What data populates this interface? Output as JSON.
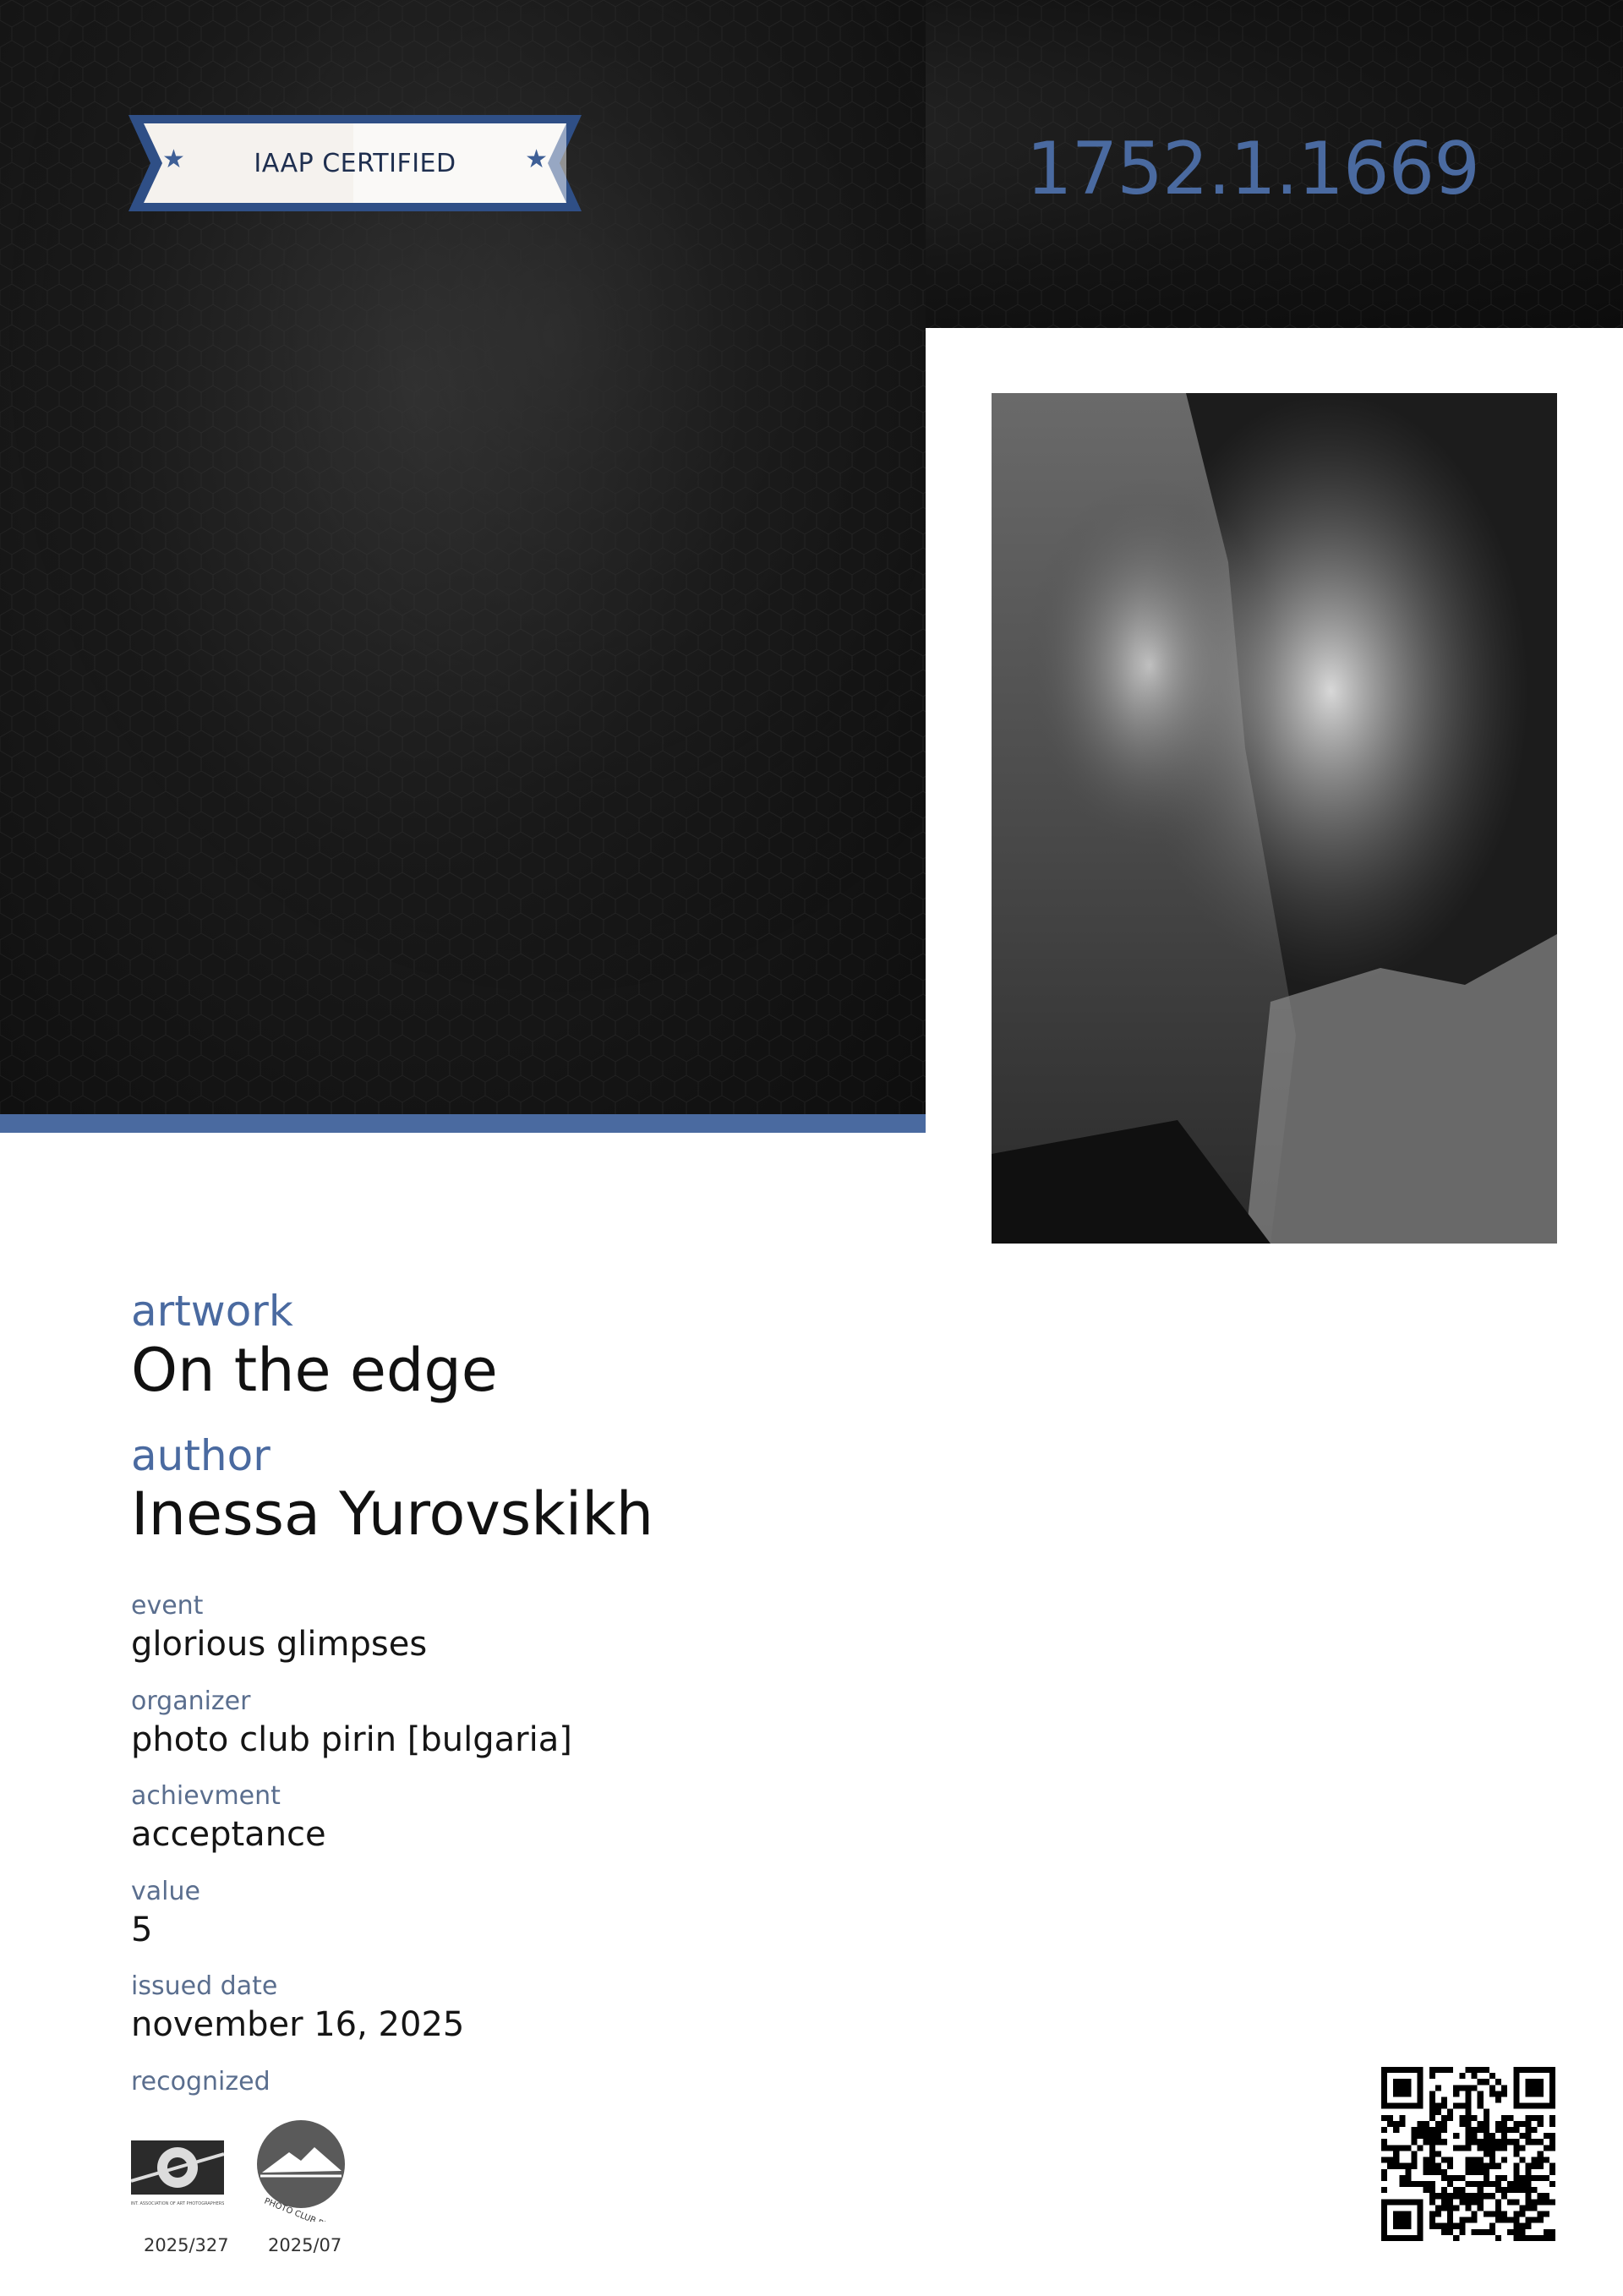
{
  "header": {
    "badge_label": "IAAP CERTIFIED",
    "badge_star_icon": "star-icon",
    "certificate_number": "1752.1.1669"
  },
  "colors": {
    "accent": "#4a6aa0",
    "badge_border": "#2f4f86",
    "badge_fill": "#f5f2ee",
    "hero_dark": "#141414"
  },
  "artwork": {
    "label": "artwork",
    "value": "On the edge"
  },
  "author": {
    "label": "author",
    "value": "Inessa Yurovskikh"
  },
  "details": [
    {
      "label": "event",
      "value": "glorious glimpses"
    },
    {
      "label": "organizer",
      "value": "photo club pirin [bulgaria]"
    },
    {
      "label": "achievment",
      "value": "acceptance"
    },
    {
      "label": "value",
      "value": "5"
    },
    {
      "label": "issued date",
      "value": "november 16, 2025"
    }
  ],
  "recognized": {
    "label": "recognized",
    "logos": [
      {
        "name": "iaap-logo",
        "code": "2025/327",
        "logo_text": "INT. ASSOCIATION OF ART PHOTOGRAPHERS"
      },
      {
        "name": "photo-club-pirin-logo",
        "code": "2025/07",
        "logo_text": "PHOTO CLUB PIRIN"
      }
    ]
  },
  "qr": {
    "icon": "qr-code-icon"
  }
}
